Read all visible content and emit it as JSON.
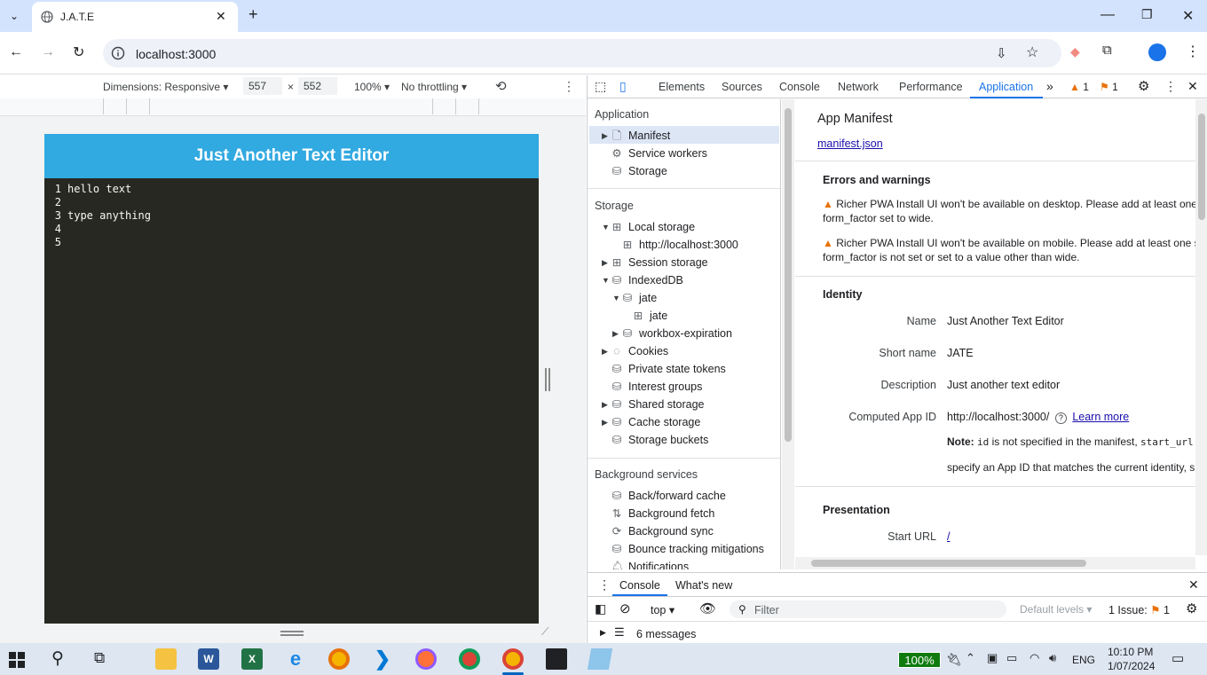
{
  "browser": {
    "tab_title": "J.A.T.E",
    "url": "localhost:3000"
  },
  "device_toolbar": {
    "dimensions_label": "Dimensions: Responsive",
    "width": "557",
    "times": "×",
    "height": "552",
    "zoom": "100%",
    "throttling": "No throttling"
  },
  "app": {
    "title": "Just Another Text Editor",
    "lines": [
      {
        "num": "1",
        "text": "hello text"
      },
      {
        "num": "2",
        "text": ""
      },
      {
        "num": "3",
        "text": "type anything"
      },
      {
        "num": "4",
        "text": ""
      },
      {
        "num": "5",
        "text": ""
      }
    ],
    "header_color": "#31a9e1",
    "editor_bg": "#272822"
  },
  "devtools": {
    "tabs": [
      "Elements",
      "Sources",
      "Console",
      "Network",
      "Performance",
      "Application"
    ],
    "active_tab": "Application",
    "warnings_count": "1",
    "issues_count": "1",
    "sidebar": {
      "application_heading": "Application",
      "app_items": [
        "Manifest",
        "Service workers",
        "Storage"
      ],
      "storage_heading": "Storage",
      "storage_items": [
        "Local storage",
        "http://localhost:3000",
        "Session storage",
        "IndexedDB",
        "jate",
        "jate",
        "workbox-expiration",
        "Cookies",
        "Private state tokens",
        "Interest groups",
        "Shared storage",
        "Cache storage",
        "Storage buckets"
      ],
      "bg_heading": "Background services",
      "bg_items": [
        "Back/forward cache",
        "Background fetch",
        "Background sync",
        "Bounce tracking mitigations",
        "Notifications"
      ]
    },
    "manifest": {
      "title": "App Manifest",
      "link": "manifest.json",
      "errors_heading": "Errors and warnings",
      "warning1_a": "Richer PWA Install UI won't be available on desktop. Please add at least one",
      "warning1_b": "form_factor set to wide.",
      "warning2_a": "Richer PWA Install UI won't be available on mobile. Please add at least one s",
      "warning2_b": "form_factor is not set or set to a value other than wide.",
      "identity_heading": "Identity",
      "name_label": "Name",
      "name_value": "Just Another Text Editor",
      "short_label": "Short name",
      "short_value": "JATE",
      "desc_label": "Description",
      "desc_value": "Just another text editor",
      "appid_label": "Computed App ID",
      "appid_value": "http://localhost:3000/",
      "learn_more": "Learn more",
      "note_bold": "Note:",
      "note_code1": "id",
      "note_text1": "is not specified in the manifest,",
      "note_code2": "start_url",
      "note_text2": "specify an App ID that matches the current identity, s",
      "presentation_heading": "Presentation",
      "start_url_label": "Start URL",
      "start_url_value": "/"
    },
    "drawer": {
      "tabs": [
        "Console",
        "What's new"
      ],
      "context": "top",
      "filter_placeholder": "Filter",
      "levels": "Default levels",
      "issues_label": "1 Issue:",
      "issues_count": "1",
      "messages": "6 messages"
    }
  },
  "taskbar": {
    "battery": "100%",
    "language": "ENG",
    "time": "10:10 PM",
    "date": "1/07/2024"
  }
}
